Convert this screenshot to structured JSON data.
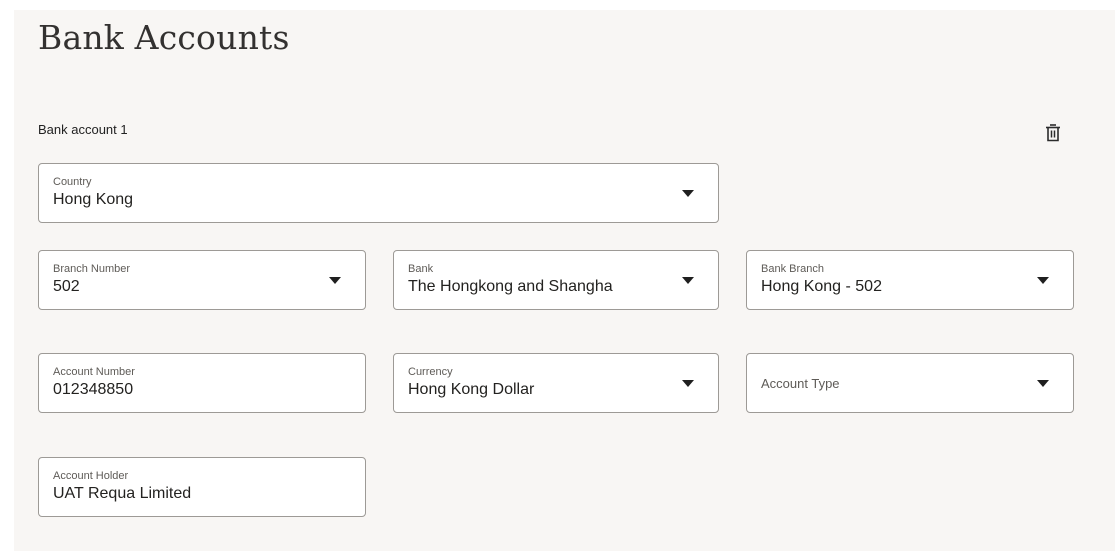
{
  "page": {
    "title": "Bank Accounts",
    "section_label": "Bank account 1"
  },
  "icons": {
    "delete": "trash-icon",
    "dropdown": "caret-down-icon"
  },
  "fields": {
    "country": {
      "label": "Country",
      "value": "Hong Kong"
    },
    "branch_number": {
      "label": "Branch Number",
      "value": "502"
    },
    "bank": {
      "label": "Bank",
      "value": "The Hongkong and Shangha"
    },
    "bank_branch": {
      "label": "Bank Branch",
      "value": "Hong Kong - 502"
    },
    "account_number": {
      "label": "Account Number",
      "value": "012348850"
    },
    "currency": {
      "label": "Currency",
      "value": "Hong Kong Dollar"
    },
    "account_type": {
      "placeholder": "Account Type",
      "value": ""
    },
    "account_holder": {
      "label": "Account Holder",
      "value": "UAT Requa Limited"
    }
  },
  "colors": {
    "panel_background": "#f8f6f4",
    "field_border": "#9d9a96"
  }
}
